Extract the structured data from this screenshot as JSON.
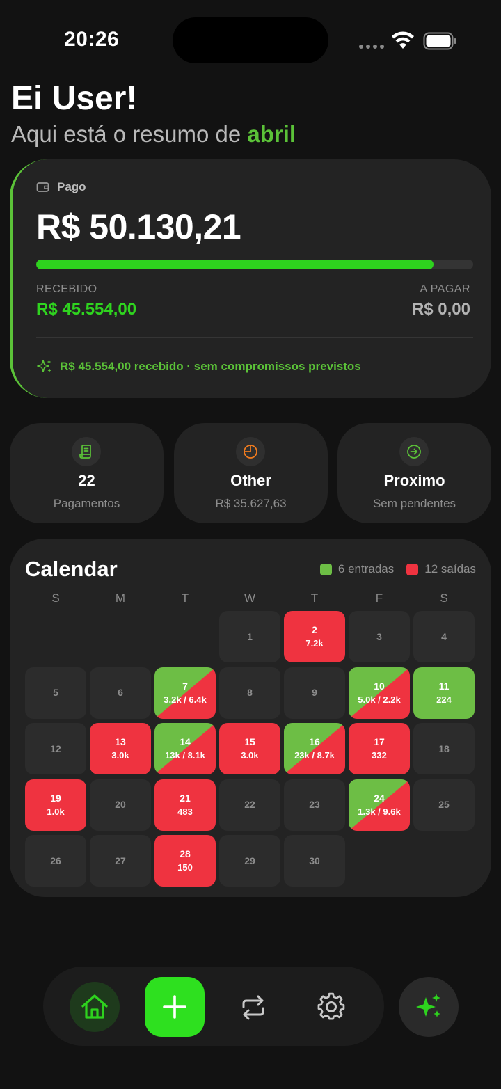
{
  "status": {
    "time": "20:26"
  },
  "greeting": {
    "title": "Ei User!",
    "subtitle_prefix": "Aqui está o resumo de",
    "month": "abril"
  },
  "summary": {
    "paid_label": "Pago",
    "paid_amount": "R$ 50.130,21",
    "progress_fraction": 0.91,
    "received_label": "RECEBIDO",
    "received_value": "R$ 45.554,00",
    "to_pay_label": "A PAGAR",
    "to_pay_value": "R$ 0,00",
    "note": "R$ 45.554,00 recebido · sem compromissos previstos"
  },
  "stats": [
    {
      "icon": "receipt-icon",
      "value": "22",
      "label": "Pagamentos"
    },
    {
      "icon": "pie-chart-icon",
      "value": "Other",
      "label": "R$ 35.627,63"
    },
    {
      "icon": "arrow-right-circle-icon",
      "value": "Proximo",
      "label": "Sem pendentes"
    }
  ],
  "calendar": {
    "title": "Calendar",
    "legend_in": "6 entradas",
    "legend_out": "12 saídas",
    "weekdays": [
      "S",
      "M",
      "T",
      "W",
      "T",
      "F",
      "S"
    ],
    "days": [
      {
        "day": "1"
      },
      {
        "day": "2",
        "status": "out",
        "amount": "7.2k"
      },
      {
        "day": "3"
      },
      {
        "day": "4"
      },
      {
        "day": "5"
      },
      {
        "day": "6"
      },
      {
        "day": "7",
        "status": "both",
        "amount": "3.2k / 6.4k"
      },
      {
        "day": "8"
      },
      {
        "day": "9"
      },
      {
        "day": "10",
        "status": "both",
        "amount": "5.0k / 2.2k"
      },
      {
        "day": "11",
        "status": "in",
        "amount": "224"
      },
      {
        "day": "12"
      },
      {
        "day": "13",
        "status": "out",
        "amount": "3.0k"
      },
      {
        "day": "14",
        "status": "both",
        "amount": "13k / 8.1k"
      },
      {
        "day": "15",
        "status": "out",
        "amount": "3.0k"
      },
      {
        "day": "16",
        "status": "both",
        "amount": "23k / 8.7k"
      },
      {
        "day": "17",
        "status": "out",
        "amount": "332"
      },
      {
        "day": "18"
      },
      {
        "day": "19",
        "status": "out",
        "amount": "1.0k"
      },
      {
        "day": "20"
      },
      {
        "day": "21",
        "status": "out",
        "amount": "483"
      },
      {
        "day": "22"
      },
      {
        "day": "23"
      },
      {
        "day": "24",
        "status": "both",
        "amount": "1.3k / 9.6k"
      },
      {
        "day": "25"
      },
      {
        "day": "26"
      },
      {
        "day": "27"
      },
      {
        "day": "28",
        "status": "out",
        "amount": "150"
      },
      {
        "day": "29"
      },
      {
        "day": "30"
      }
    ]
  },
  "colors": {
    "accent": "#2ed21e",
    "income": "#6dbe45",
    "expense": "#ef3340",
    "card": "#232323"
  },
  "tabbar": {
    "icons": [
      "home-icon",
      "plus-icon",
      "repeat-icon",
      "gear-icon"
    ],
    "ai_icon": "sparkles-icon"
  }
}
